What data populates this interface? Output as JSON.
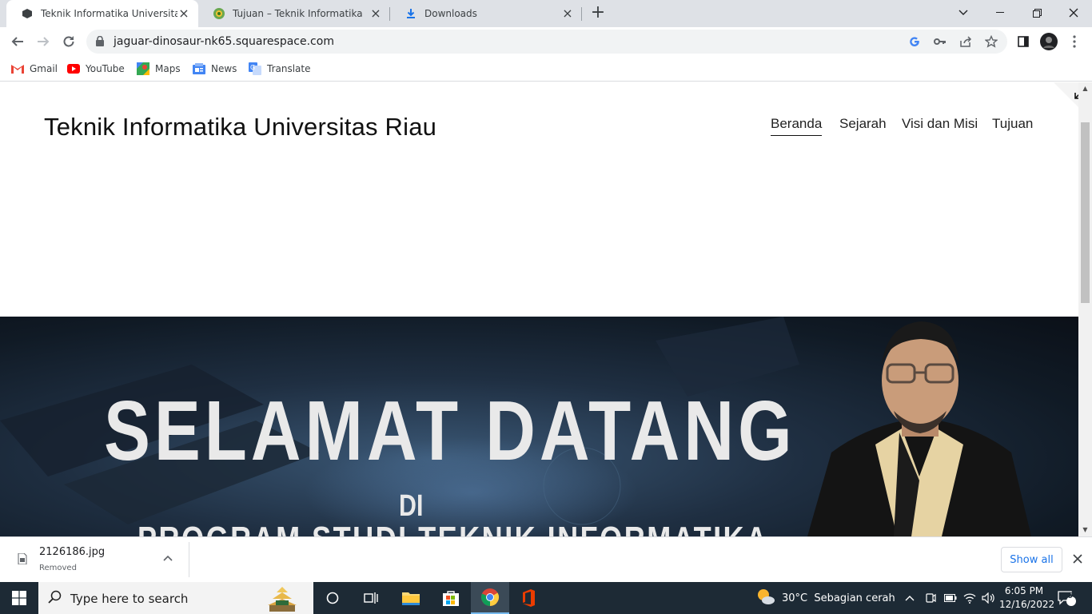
{
  "browser": {
    "tabs": [
      {
        "title": "Teknik Informatika Universitas Riau",
        "active": true
      },
      {
        "title": "Tujuan – Teknik Informatika",
        "active": false
      },
      {
        "title": "Downloads",
        "active": false
      }
    ],
    "url": "jaguar-dinosaur-nk65.squarespace.com",
    "bookmarks": [
      "Gmail",
      "YouTube",
      "Maps",
      "News",
      "Translate"
    ]
  },
  "site": {
    "title": "Teknik Informatika Universitas Riau",
    "nav": [
      "Beranda",
      "Sejarah",
      "Visi dan Misi",
      "Tujuan"
    ],
    "active_nav": "Beranda",
    "hero": {
      "line1": "SELAMAT DATANG",
      "line2": "DI",
      "line3": "PROGRAM STUDI TEKNIK INFORMATIKA"
    }
  },
  "downloads": {
    "file_name": "2126186.jpg",
    "status": "Removed",
    "show_all": "Show all"
  },
  "taskbar": {
    "search_placeholder": "Type here to search",
    "weather": "30°C  Sebagian cerah",
    "time": "6:05 PM",
    "date": "12/16/2022",
    "notifications": "6"
  },
  "colors": {
    "accent": "#1a73e8",
    "taskbar": "#1d2a35",
    "tabstrip": "#dee1e6"
  }
}
